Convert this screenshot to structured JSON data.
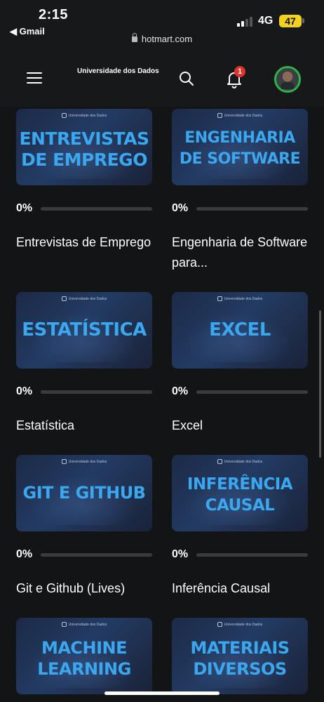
{
  "status_bar": {
    "time": "2:15",
    "back_app": "◀ Gmail",
    "network": "4G",
    "battery": "47",
    "url": "hotmart.com"
  },
  "header": {
    "brand": "Universidade dos Dados",
    "notification_count": "1"
  },
  "thumb_brand": "Universidade dos Dados",
  "courses": [
    {
      "thumb_title": "ENTREVISTAS\nDE EMPREGO",
      "progress_label": "0%",
      "progress": 0,
      "title": "Entrevistas de Emprego"
    },
    {
      "thumb_title": "ENGENHARIA\nDE SOFTWARE",
      "progress_label": "0%",
      "progress": 0,
      "title": "Engenharia de Software para..."
    },
    {
      "thumb_title": "ESTATÍSTICA",
      "progress_label": "0%",
      "progress": 0,
      "title": "Estatística"
    },
    {
      "thumb_title": "EXCEL",
      "progress_label": "0%",
      "progress": 0,
      "title": "Excel"
    },
    {
      "thumb_title": "GIT E GITHUB",
      "progress_label": "0%",
      "progress": 0,
      "title": "Git e Github (Lives)"
    },
    {
      "thumb_title": "INFERÊNCIA\nCAUSAL",
      "progress_label": "0%",
      "progress": 0,
      "title": "Inferência Causal"
    },
    {
      "thumb_title": "MACHINE\nLEARNING",
      "progress_label": "",
      "progress": 0,
      "title": ""
    },
    {
      "thumb_title": "MATERIAIS\nDIVERSOS",
      "progress_label": "",
      "progress": 0,
      "title": ""
    }
  ],
  "colors": {
    "background": "#131416",
    "header": "#17181a",
    "accent": "#3aa7ee",
    "badge": "#e0322d",
    "avatar_ring": "#2db34a",
    "battery": "#f2d21c"
  },
  "icons": [
    "menu-icon",
    "search-icon",
    "bell-icon",
    "lock-icon",
    "avatar"
  ]
}
